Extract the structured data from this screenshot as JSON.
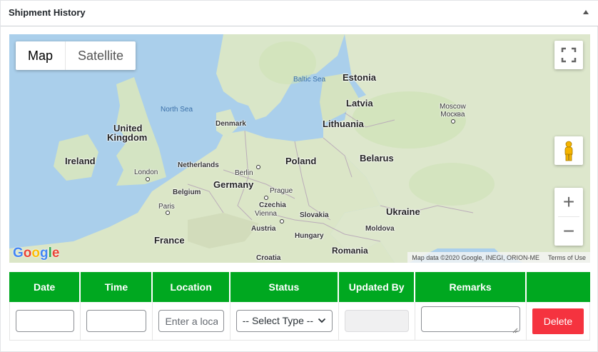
{
  "panel": {
    "title": "Shipment History"
  },
  "map": {
    "type_buttons": [
      {
        "label": "Map",
        "active": true
      },
      {
        "label": "Satellite",
        "active": false
      }
    ],
    "labels": {
      "north_sea": "North Sea",
      "baltic_sea": "Baltic Sea",
      "estonia": "Estonia",
      "latvia": "Latvia",
      "lithuania": "Lithuania",
      "moscow": "Moscow\nМосква",
      "moscow_en": "Moscow",
      "moscow_ru": "Москва",
      "denmark": "Denmark",
      "united": "United",
      "kingdom": "Kingdom",
      "ireland": "Ireland",
      "london": "London",
      "netherlands": "Netherlands",
      "berlin": "Berlin",
      "germany": "Germany",
      "poland": "Poland",
      "belarus": "Belarus",
      "belgium": "Belgium",
      "prague": "Prague",
      "czechia": "Czechia",
      "paris": "Paris",
      "vienna": "Vienna",
      "slovakia": "Slovakia",
      "ukraine": "Ukraine",
      "austria": "Austria",
      "moldova": "Moldova",
      "france": "France",
      "hungary": "Hungary",
      "croatia": "Croatia",
      "romania": "Romania"
    },
    "google_logo": "Google",
    "attribution": "Map data ©2020 Google, INEGI, ORION-ME",
    "terms": "Terms of Use",
    "zoom_in": "+",
    "zoom_out": "−"
  },
  "table": {
    "headers": [
      "Date",
      "Time",
      "Location",
      "Status",
      "Updated By",
      "Remarks",
      ""
    ],
    "row": {
      "date_value": "",
      "time_value": "",
      "location_placeholder": "Enter a location",
      "status_selected": "-- Select Type --",
      "updated_by_value": "",
      "remarks_value": "",
      "delete_label": "Delete"
    }
  },
  "colors": {
    "header_green": "#00a820",
    "delete_red": "#f5333f",
    "water": "#a9cfec",
    "land": "#dfe8cf"
  }
}
